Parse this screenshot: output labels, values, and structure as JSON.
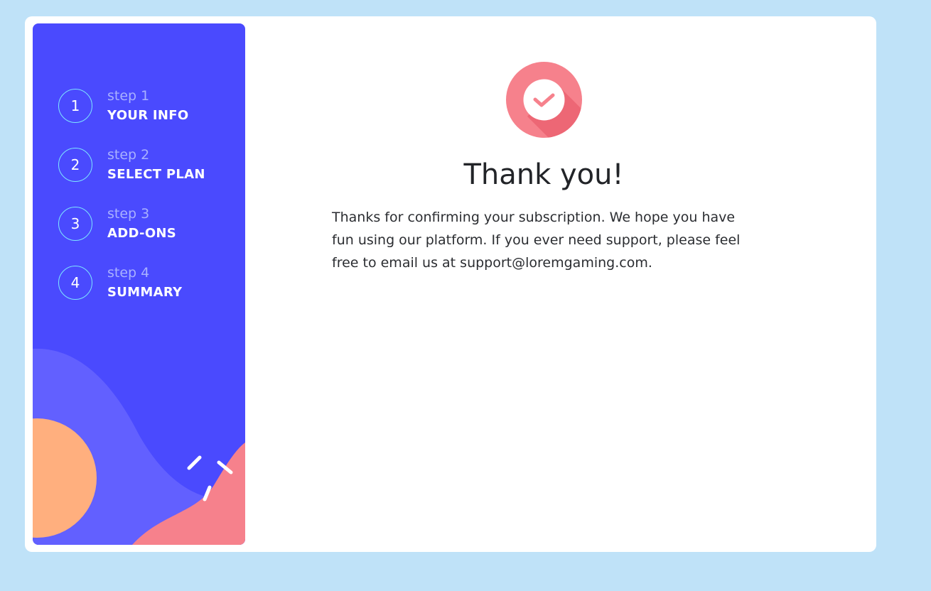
{
  "steps": [
    {
      "number": "1",
      "label": "step 1",
      "title": "YOUR INFO"
    },
    {
      "number": "2",
      "label": "step 2",
      "title": "SELECT PLAN"
    },
    {
      "number": "3",
      "label": "step 3",
      "title": "ADD-ONS"
    },
    {
      "number": "4",
      "label": "step 4",
      "title": "SUMMARY"
    }
  ],
  "confirmation": {
    "icon": "checkmark-icon",
    "title": "Thank you!",
    "message": "Thanks for confirming your subscription. We hope you have fun using our platform. If you ever need support, please feel free to email us at support@loremgaming.com."
  },
  "colors": {
    "page_background": "#bfe2f8",
    "sidebar": "#4a4afe",
    "accent_pink": "#f6818c",
    "accent_orange": "#ffaf7e"
  }
}
